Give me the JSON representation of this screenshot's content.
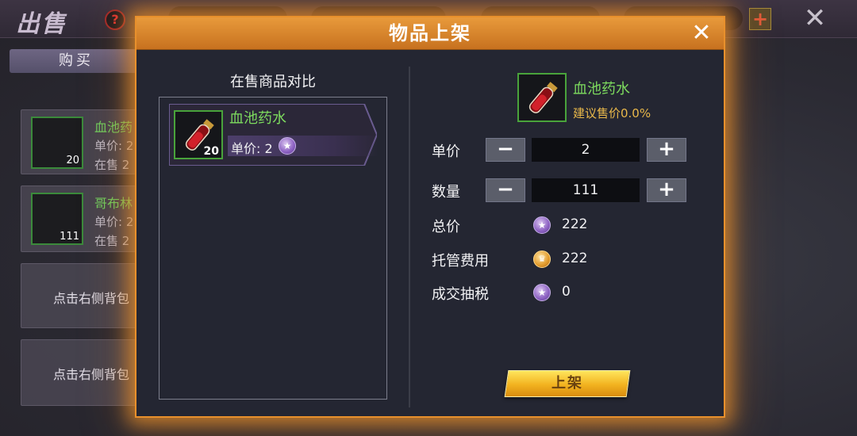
{
  "background": {
    "title": "出售",
    "help_icon_text": "?",
    "tab_buy": "购买",
    "cards": [
      {
        "count": "20",
        "name": "血池药",
        "line1": "单价: 2",
        "line2": "在售 2"
      },
      {
        "count": "111",
        "name": "哥布林",
        "line1": "单价: 2",
        "line2": "在售 2"
      }
    ],
    "hints": [
      "点击右侧背包",
      "点击右侧背包"
    ],
    "plus_icon": "+",
    "close_icon": "✕"
  },
  "modal": {
    "title": "物品上架",
    "close_icon": "✕",
    "compare": {
      "title": "在售商品对比",
      "items": [
        {
          "name": "血池药水",
          "count": "20",
          "price_label": "单价: 2",
          "currency_icon": "star-coin-icon"
        }
      ]
    },
    "detail": {
      "item_name": "血池药水",
      "suggest": "建议售价0.0%",
      "unit_price_label": "单价",
      "unit_price_value": "2",
      "quantity_label": "数量",
      "quantity_value": "111",
      "minus_glyph": "−",
      "plus_glyph": "+",
      "total_label": "总价",
      "total_value": "222",
      "fee_label": "托管费用",
      "fee_value": "222",
      "tax_label": "成交抽税",
      "tax_value": "0"
    },
    "submit_label": "上架"
  },
  "colors": {
    "accent_orange": "#e8902c",
    "item_green": "#7ddb5e",
    "suggest_gold": "#e9b84a",
    "button_gold": "#f2b21f"
  }
}
